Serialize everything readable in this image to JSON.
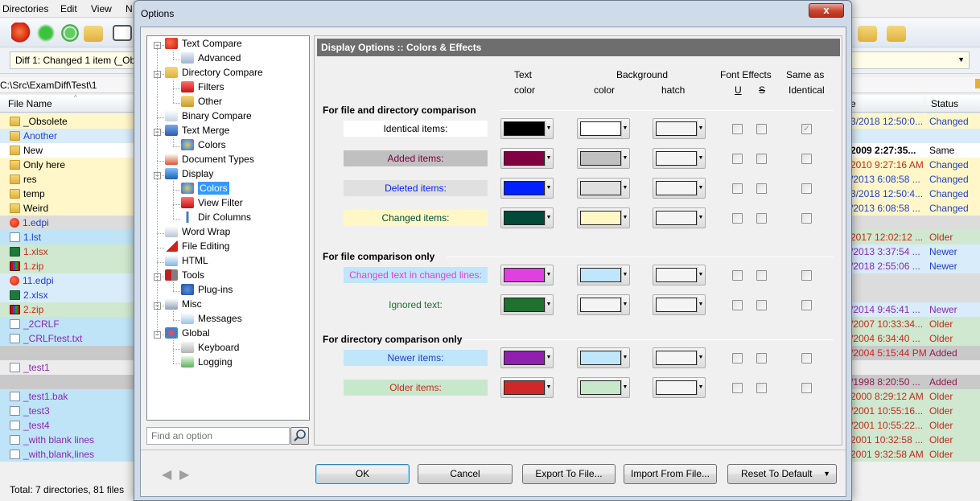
{
  "bg": {
    "menu": [
      "Directories",
      "Edit",
      "View",
      "N"
    ],
    "diff_combo": "Diff 1: Changed 1 item (_Ob",
    "path": "C:\\Src\\ExamDiff\\Test\\1",
    "col_filename": "File Name",
    "col_status": "Status",
    "col_date_partial": "e",
    "left_rows": [
      {
        "name": "_Obsolete",
        "icon": "folder",
        "bg": "#fff7c9",
        "color": "#000000"
      },
      {
        "name": "Another",
        "icon": "folder",
        "bg": "#d9ecf9",
        "color": "#1f3fd1"
      },
      {
        "name": "New",
        "icon": "folder",
        "bg": "#ffffff",
        "color": "#000000"
      },
      {
        "name": "Only here",
        "icon": "folder",
        "bg": "#fff7c9",
        "color": "#000000"
      },
      {
        "name": "res",
        "icon": "folder",
        "bg": "#fff7c9",
        "color": "#000000"
      },
      {
        "name": "temp",
        "icon": "folder",
        "bg": "#fff7c9",
        "color": "#000000"
      },
      {
        "name": "Weird",
        "icon": "folder",
        "bg": "#fff7c9",
        "color": "#000000"
      },
      {
        "name": "1.edpi",
        "icon": "apple",
        "bg": "#dcdcdc",
        "color": "#1f3fd1"
      },
      {
        "name": "1.lst",
        "icon": "doc",
        "bg": "#bfe4f7",
        "color": "#1f3fd1"
      },
      {
        "name": "1.xlsx",
        "icon": "xl",
        "bg": "#cfe8cf",
        "color": "#c8281e"
      },
      {
        "name": "1.zip",
        "icon": "zip",
        "bg": "#cfe8cf",
        "color": "#c8281e"
      },
      {
        "name": "11.edpi",
        "icon": "apple",
        "bg": "#d9ecf9",
        "color": "#1f3fd1"
      },
      {
        "name": "2.xlsx",
        "icon": "xl",
        "bg": "#d9ecf9",
        "color": "#1f3fd1"
      },
      {
        "name": "2.zip",
        "icon": "zip",
        "bg": "#cfe8cf",
        "color": "#c8281e"
      },
      {
        "name": "_2CRLF",
        "icon": "doc",
        "bg": "#bfe4f7",
        "color": "#8a27b8"
      },
      {
        "name": "_CRLFtest.txt",
        "icon": "doc",
        "bg": "#bfe4f7",
        "color": "#8a27b8"
      },
      {
        "name": "",
        "icon": "none",
        "bg": "#c9c9c9",
        "color": "#000000"
      },
      {
        "name": "_test1",
        "icon": "doc",
        "bg": "#ececec",
        "color": "#8a27b8"
      },
      {
        "name": "",
        "icon": "none",
        "bg": "#c9c9c9",
        "color": "#000000"
      },
      {
        "name": "_test1.bak",
        "icon": "doc",
        "bg": "#bfe4f7",
        "color": "#8a27b8"
      },
      {
        "name": "_test3",
        "icon": "doc",
        "bg": "#bfe4f7",
        "color": "#8a27b8"
      },
      {
        "name": "_test4",
        "icon": "doc",
        "bg": "#bfe4f7",
        "color": "#8a27b8"
      },
      {
        "name": "_with blank lines",
        "icon": "doc",
        "bg": "#bfe4f7",
        "color": "#8a27b8"
      },
      {
        "name": "_with,blank,lines",
        "icon": "doc",
        "bg": "#bfe4f7",
        "color": "#8a27b8"
      }
    ],
    "right_rows": [
      {
        "date": "3/2018 12:50:0...",
        "status": "Changed",
        "bg": "#fff7c9",
        "color": "#1f3fd1",
        "scolor": "#1f3fd1"
      },
      {
        "date": "",
        "status": "",
        "bg": "#d9ecf9",
        "color": "#000000",
        "scolor": "#000000"
      },
      {
        "date": "2009 2:27:35...",
        "status": "Same",
        "bg": "#ffffff",
        "color": "#000000",
        "scolor": "#000000",
        "bold": true
      },
      {
        "date": "2010 9:27:16 AM",
        "status": "Changed",
        "bg": "#fff7c9",
        "color": "#c8281e",
        "scolor": "#1f3fd1"
      },
      {
        "date": "/2013 6:08:58 ...",
        "status": "Changed",
        "bg": "#fff7c9",
        "color": "#1f3fd1",
        "scolor": "#1f3fd1"
      },
      {
        "date": "3/2018 12:50:4...",
        "status": "Changed",
        "bg": "#fff7c9",
        "color": "#1f3fd1",
        "scolor": "#1f3fd1"
      },
      {
        "date": "/2013 6:08:58 ...",
        "status": "Changed",
        "bg": "#fff7c9",
        "color": "#1f3fd1",
        "scolor": "#1f3fd1"
      },
      {
        "date": "",
        "status": "",
        "bg": "#dcdcdc",
        "color": "#000000",
        "scolor": "#000000"
      },
      {
        "date": "2017 12:02:12 ...",
        "status": "Older",
        "bg": "#cfe8cf",
        "color": "#c8281e",
        "scolor": "#c8281e"
      },
      {
        "date": "/2013 3:37:54 ...",
        "status": "Newer",
        "bg": "#d9ecf9",
        "color": "#8a27b8",
        "scolor": "#1f3fd1"
      },
      {
        "date": "/2018 2:55:06 ...",
        "status": "Newer",
        "bg": "#d9ecf9",
        "color": "#8a27b8",
        "scolor": "#1f3fd1"
      },
      {
        "date": "",
        "status": "",
        "bg": "#dcdcdc",
        "color": "#000000",
        "scolor": "#000000"
      },
      {
        "date": "",
        "status": "",
        "bg": "#dcdcdc",
        "color": "#000000",
        "scolor": "#000000"
      },
      {
        "date": "/2014 9:45:41 ...",
        "status": "Newer",
        "bg": "#d9ecf9",
        "color": "#8a27b8",
        "scolor": "#8a27b8"
      },
      {
        "date": "/2007 10:33:34...",
        "status": "Older",
        "bg": "#cfe8cf",
        "color": "#c8281e",
        "scolor": "#c8281e"
      },
      {
        "date": "/2004 6:34:40 ...",
        "status": "Older",
        "bg": "#cfe8cf",
        "color": "#c8281e",
        "scolor": "#c8281e"
      },
      {
        "date": "/2004 5:15:44 PM",
        "status": "Added",
        "bg": "#c9c9c9",
        "color": "#c8281e",
        "scolor": "#8a1f4f"
      },
      {
        "date": "",
        "status": "",
        "bg": "#ececec",
        "color": "#000000",
        "scolor": "#000000"
      },
      {
        "date": "/1998 8:20:50 ...",
        "status": "Added",
        "bg": "#c9c9c9",
        "color": "#8a1f4f",
        "scolor": "#8a1f4f"
      },
      {
        "date": "2000 8:29:12 AM",
        "status": "Older",
        "bg": "#cfe8cf",
        "color": "#c8281e",
        "scolor": "#c8281e"
      },
      {
        "date": "/2001 10:55:16...",
        "status": "Older",
        "bg": "#cfe8cf",
        "color": "#c8281e",
        "scolor": "#c8281e"
      },
      {
        "date": "/2001 10:55:22...",
        "status": "Older",
        "bg": "#cfe8cf",
        "color": "#c8281e",
        "scolor": "#c8281e"
      },
      {
        "date": "2001 10:32:58 ...",
        "status": "Older",
        "bg": "#cfe8cf",
        "color": "#c8281e",
        "scolor": "#c8281e"
      },
      {
        "date": "2001 9:32:58 AM",
        "status": "Older",
        "bg": "#cfe8cf",
        "color": "#c8281e",
        "scolor": "#c8281e"
      }
    ],
    "status_text": "Total: 7 directories, 81 files"
  },
  "dialog": {
    "title": "Options",
    "close_label": "x",
    "tree": [
      {
        "label": "Text Compare",
        "depth": 0,
        "icon": "apple",
        "expand": "-"
      },
      {
        "label": "Advanced",
        "depth": 1,
        "icon": "advanced"
      },
      {
        "label": "Directory Compare",
        "depth": 0,
        "icon": "folders",
        "expand": "-"
      },
      {
        "label": "Filters",
        "depth": 1,
        "icon": "filter"
      },
      {
        "label": "Other",
        "depth": 1,
        "icon": "other-folder"
      },
      {
        "label": "Binary Compare",
        "depth": 0,
        "icon": "binary"
      },
      {
        "label": "Text Merge",
        "depth": 0,
        "icon": "merge",
        "expand": "-"
      },
      {
        "label": "Colors",
        "depth": 1,
        "icon": "palette"
      },
      {
        "label": "Document Types",
        "depth": 0,
        "icon": "doctypes"
      },
      {
        "label": "Display",
        "depth": 0,
        "icon": "display",
        "expand": "-"
      },
      {
        "label": "Colors",
        "depth": 1,
        "icon": "palette",
        "selected": true
      },
      {
        "label": "View Filter",
        "depth": 1,
        "icon": "filter"
      },
      {
        "label": "Dir Columns",
        "depth": 1,
        "icon": "columns"
      },
      {
        "label": "Word Wrap",
        "depth": 0,
        "icon": "wordwrap"
      },
      {
        "label": "File Editing",
        "depth": 0,
        "icon": "edit"
      },
      {
        "label": "HTML",
        "depth": 0,
        "icon": "html"
      },
      {
        "label": "Tools",
        "depth": 0,
        "icon": "tools",
        "expand": "-"
      },
      {
        "label": "Plug-ins",
        "depth": 1,
        "icon": "plugin"
      },
      {
        "label": "Misc",
        "depth": 0,
        "icon": "misc",
        "expand": "-"
      },
      {
        "label": "Messages",
        "depth": 1,
        "icon": "messages"
      },
      {
        "label": "Global",
        "depth": 0,
        "icon": "global",
        "expand": "-"
      },
      {
        "label": "Keyboard",
        "depth": 1,
        "icon": "keyboard"
      },
      {
        "label": "Logging",
        "depth": 1,
        "icon": "logging"
      }
    ],
    "search_placeholder": "Find an option",
    "panel_title": "Display Options :: Colors & Effects",
    "headers": {
      "text": "Text",
      "text_color": "color",
      "background": "Background",
      "bg_color": "color",
      "bg_hatch": "hatch",
      "font_effects": "Font Effects",
      "underline": "U",
      "strike": "S",
      "same_as": "Same as",
      "identical": "Identical"
    },
    "sections": [
      {
        "title": "For file and directory comparison",
        "rows": [
          {
            "label": "Identical items:",
            "sample_bg": "#ffffff",
            "sample_fg": "#000000",
            "text_color": "#000000",
            "bg_color": "#ffffff",
            "hatch": "#f4f4f4",
            "same_checked": true
          },
          {
            "label": "Added items:",
            "sample_bg": "#c0c0c0",
            "sample_fg": "#800040",
            "text_color": "#800040",
            "bg_color": "#c0c0c0",
            "hatch": "#f4f4f4",
            "same_checked": false
          },
          {
            "label": "Deleted items:",
            "sample_bg": "#e0e0e0",
            "sample_fg": "#0020ff",
            "text_color": "#0020ff",
            "bg_color": "#e0e0e0",
            "hatch": "#f4f4f4",
            "same_checked": false
          },
          {
            "label": "Changed items:",
            "sample_bg": "#fff8c6",
            "sample_fg": "#004a3a",
            "text_color": "#004a3a",
            "bg_color": "#fff8c6",
            "hatch": "#f4f4f4",
            "same_checked": false
          }
        ]
      },
      {
        "title": "For file comparison only",
        "rows": [
          {
            "label": "Changed text in changed lines:",
            "sample_bg": "#bfe6fa",
            "sample_fg": "#e040e0",
            "text_color": "#e040e0",
            "bg_color": "#bfe6fa",
            "hatch": "#f4f4f4",
            "same_checked": false
          },
          {
            "label": "Ignored text:",
            "sample_bg": "#f0f0f0",
            "sample_fg": "#207030",
            "text_color": "#207030",
            "bg_color": "#f4f4f4",
            "hatch": "#f4f4f4",
            "same_checked": false
          }
        ]
      },
      {
        "title": "For directory comparison only",
        "rows": [
          {
            "label": "Newer items:",
            "sample_bg": "#c0e6fa",
            "sample_fg": "#1f3fd1",
            "text_color": "#9020b0",
            "bg_color": "#c0e6fa",
            "hatch": "#f4f4f4",
            "same_checked": false
          },
          {
            "label": "Older items:",
            "sample_bg": "#c8e8cc",
            "sample_fg": "#c8281e",
            "text_color": "#d02828",
            "bg_color": "#c8e8cc",
            "hatch": "#f4f4f4",
            "same_checked": false
          }
        ]
      }
    ],
    "buttons": {
      "ok": "OK",
      "cancel": "Cancel",
      "export": "Export To File...",
      "import": "Import From File...",
      "reset": "Reset To Default"
    }
  }
}
